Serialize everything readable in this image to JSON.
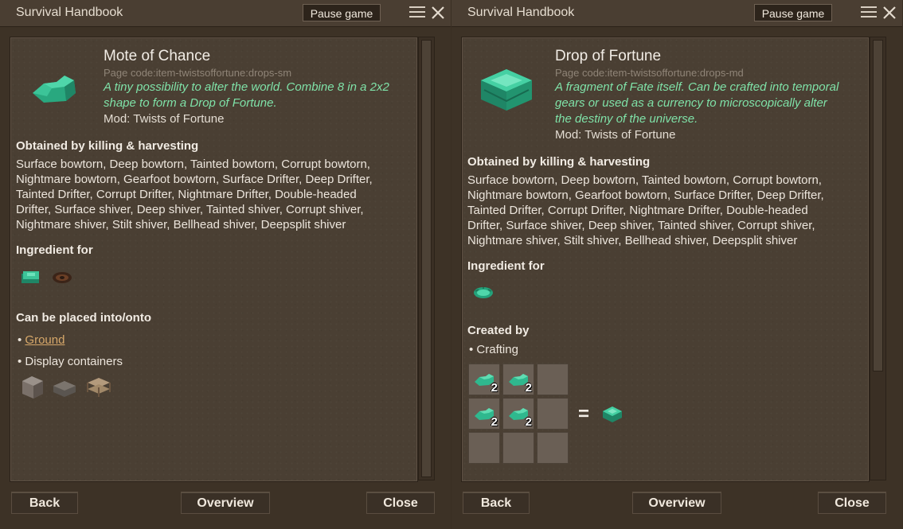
{
  "windows": {
    "left": {
      "title": "Survival Handbook",
      "pause_label": "Pause game",
      "item_title": "Mote of Chance",
      "page_code": "Page code:item-twistsoffortune:drops-sm",
      "desc_lines": [
        "A tiny possibility to alter the world. Combine 8 in a 2x2",
        "shape to form a Drop of Fortune."
      ],
      "mod": "Mod: Twists of Fortune",
      "obtained_title": "Obtained by killing & harvesting",
      "obtained_lines": [
        " Surface bowtorn, Deep bowtorn, Tainted bowtorn, Corrupt bowtorn,",
        "Nightmare bowtorn, Gearfoot bowtorn, Surface Drifter, Deep Drifter,",
        "Tainted Drifter, Corrupt Drifter, Nightmare Drifter, Double-headed",
        "Drifter, Surface shiver, Deep shiver, Tainted shiver, Corrupt shiver,",
        "Nightmare shiver, Stilt shiver, Bellhead shiver, Deepsplit shiver"
      ],
      "ingredient_title": "Ingredient for",
      "placed_title": "Can be placed into/onto",
      "placed_items": [
        "Ground",
        "Display containers"
      ],
      "buttons": {
        "back": "Back",
        "overview": "Overview",
        "close": "Close"
      }
    },
    "right": {
      "title": "Survival Handbook",
      "pause_label": "Pause game",
      "item_title": "Drop of Fortune",
      "page_code": "Page code:item-twistsoffortune:drops-md",
      "desc_lines": [
        "A fragment of Fate itself. Can be crafted into temporal",
        "gears or used as a currency to microscopically alter",
        "the destiny of the universe."
      ],
      "mod": "Mod: Twists of Fortune",
      "obtained_title": "Obtained by killing & harvesting",
      "obtained_lines": [
        " Surface bowtorn, Deep bowtorn, Tainted bowtorn, Corrupt bowtorn,",
        "Nightmare bowtorn, Gearfoot bowtorn, Surface Drifter, Deep Drifter,",
        "Tainted Drifter, Corrupt Drifter, Nightmare Drifter, Double-headed",
        "Drifter, Surface shiver, Deep shiver, Tainted shiver, Corrupt shiver,",
        "Nightmare shiver, Stilt shiver, Bellhead shiver, Deepsplit shiver"
      ],
      "ingredient_title": "Ingredient for",
      "created_title": "Created by",
      "created_method": "Crafting",
      "grid_counts": [
        "2",
        "2",
        "",
        "2",
        "2",
        "",
        "",
        "",
        ""
      ],
      "equals": "=",
      "buttons": {
        "back": "Back",
        "overview": "Overview",
        "close": "Close"
      }
    }
  },
  "colors": {
    "accent_text": "#7fe2a8",
    "link": "#d7a86a",
    "gem": "#2fb88e"
  },
  "icons": {
    "menu": "hamburger-icon",
    "close": "close-x-icon",
    "gem": "emerald-gem-icon"
  }
}
